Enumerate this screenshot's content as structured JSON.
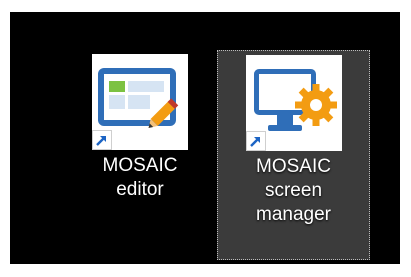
{
  "desktop": {
    "background": "#000000",
    "selected_tile_background": "#3b3b3b",
    "icons": [
      {
        "icon": "mosaic-editor-icon",
        "label_lines": [
          "MOSAIC",
          "editor"
        ],
        "shortcut_overlay": "shortcut-arrow-icon",
        "selected": false
      },
      {
        "icon": "mosaic-screen-manager-icon",
        "label_lines": [
          "MOSAIC",
          "screen",
          "manager"
        ],
        "shortcut_overlay": "shortcut-arrow-icon",
        "selected": true
      }
    ]
  },
  "colors": {
    "blue": "#2f6eb8",
    "green": "#7cc242",
    "orange": "#f39c12"
  }
}
